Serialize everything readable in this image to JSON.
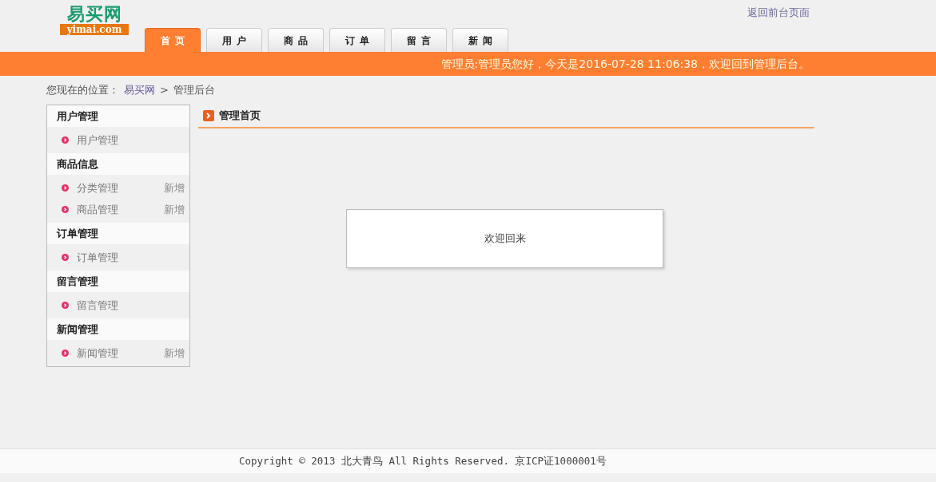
{
  "logo": {
    "name": "易买网",
    "domain": "yimai.com"
  },
  "top_link": "返回前台页面",
  "tabs": [
    {
      "label": "首页",
      "selected": true
    },
    {
      "label": "用户",
      "selected": false
    },
    {
      "label": "商品",
      "selected": false
    },
    {
      "label": "订单",
      "selected": false
    },
    {
      "label": "留言",
      "selected": false
    },
    {
      "label": "新闻",
      "selected": false
    }
  ],
  "welcome_bar": "管理员:管理员您好，今天是2016-07-28 11:06:38，欢迎回到管理后台。",
  "breadcrumb": {
    "label": "您现在的位置：",
    "items": [
      "易买网",
      "管理后台"
    ],
    "separator": ">"
  },
  "sidebar": [
    {
      "title": "用户管理",
      "items": [
        {
          "label": "用户管理"
        }
      ]
    },
    {
      "title": "商品信息",
      "items": [
        {
          "label": "分类管理",
          "action": "新增"
        },
        {
          "label": "商品管理",
          "action": "新增"
        }
      ]
    },
    {
      "title": "订单管理",
      "items": [
        {
          "label": "订单管理"
        }
      ]
    },
    {
      "title": "留言管理",
      "items": [
        {
          "label": "留言管理"
        }
      ]
    },
    {
      "title": "新闻管理",
      "items": [
        {
          "label": "新闻管理",
          "action": "新增"
        }
      ]
    }
  ],
  "main": {
    "title": "管理首页",
    "message": "欢迎回来"
  },
  "footer": "Copyright © 2013 北大青鸟 All Rights Reserved. 京ICP证1000001号"
}
